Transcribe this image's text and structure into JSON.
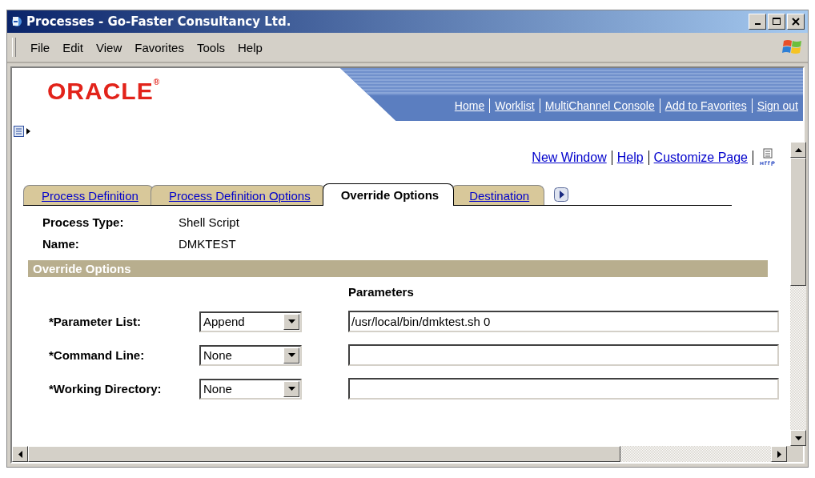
{
  "window": {
    "title": "Processes - Go-Faster Consultancy Ltd."
  },
  "menu": [
    "File",
    "Edit",
    "View",
    "Favorites",
    "Tools",
    "Help"
  ],
  "header": {
    "logo": "ORACLE",
    "logo_mark": "®",
    "links": [
      "Home",
      "Worklist",
      "MultiChannel Console",
      "Add to Favorites",
      "Sign out"
    ]
  },
  "page_links": [
    "New Window",
    "Help",
    "Customize Page"
  ],
  "tabs": [
    {
      "label": "Process Definition",
      "selected": false
    },
    {
      "label": "Process Definition Options",
      "selected": false
    },
    {
      "label": "Override Options",
      "selected": true
    },
    {
      "label": "Destination",
      "selected": false
    }
  ],
  "fields": [
    {
      "label": "Process Type:",
      "value": "Shell Script"
    },
    {
      "label": "Name:",
      "value": "DMKTEST"
    }
  ],
  "section": {
    "title": "Override Options",
    "column_header": "Parameters",
    "rows": [
      {
        "label": "*Parameter List:",
        "option": "Append",
        "parameters": "/usr/local/bin/dmktest.sh 0"
      },
      {
        "label": "*Command Line:",
        "option": "None",
        "parameters": ""
      },
      {
        "label": "*Working Directory:",
        "option": "None",
        "parameters": ""
      }
    ]
  }
}
